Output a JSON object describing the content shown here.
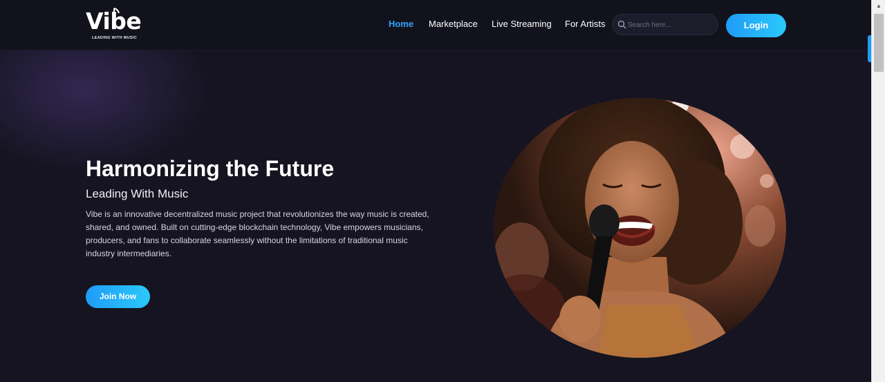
{
  "brand": {
    "name": "Vibe",
    "tagline": "LEADING WITH MUSIC"
  },
  "nav": {
    "items": [
      {
        "label": "Home",
        "active": true
      },
      {
        "label": "Marketplace",
        "active": false
      },
      {
        "label": "Live Streaming",
        "active": false
      },
      {
        "label": "For Artists",
        "active": false
      }
    ],
    "search": {
      "placeholder": "Search here...",
      "value": "",
      "icon": "search-icon"
    },
    "login_label": "Login"
  },
  "hero": {
    "title": "Harmonizing the Future",
    "subtitle": "Leading With Music",
    "description": "Vibe is an innovative decentralized music project that revolutionizes the way music is created, shared, and owned. Built on cutting-edge blockchain technology, Vibe empowers musicians, producers, and fans to collaborate seamlessly without the limitations of traditional music industry intermediaries.",
    "cta_label": "Join Now"
  },
  "colors": {
    "accent": "#1f9cf7",
    "accent_light": "#2bc8fb",
    "nav_active": "#2fa4ff",
    "background": "#15151f",
    "header_bg": "#12121c"
  }
}
